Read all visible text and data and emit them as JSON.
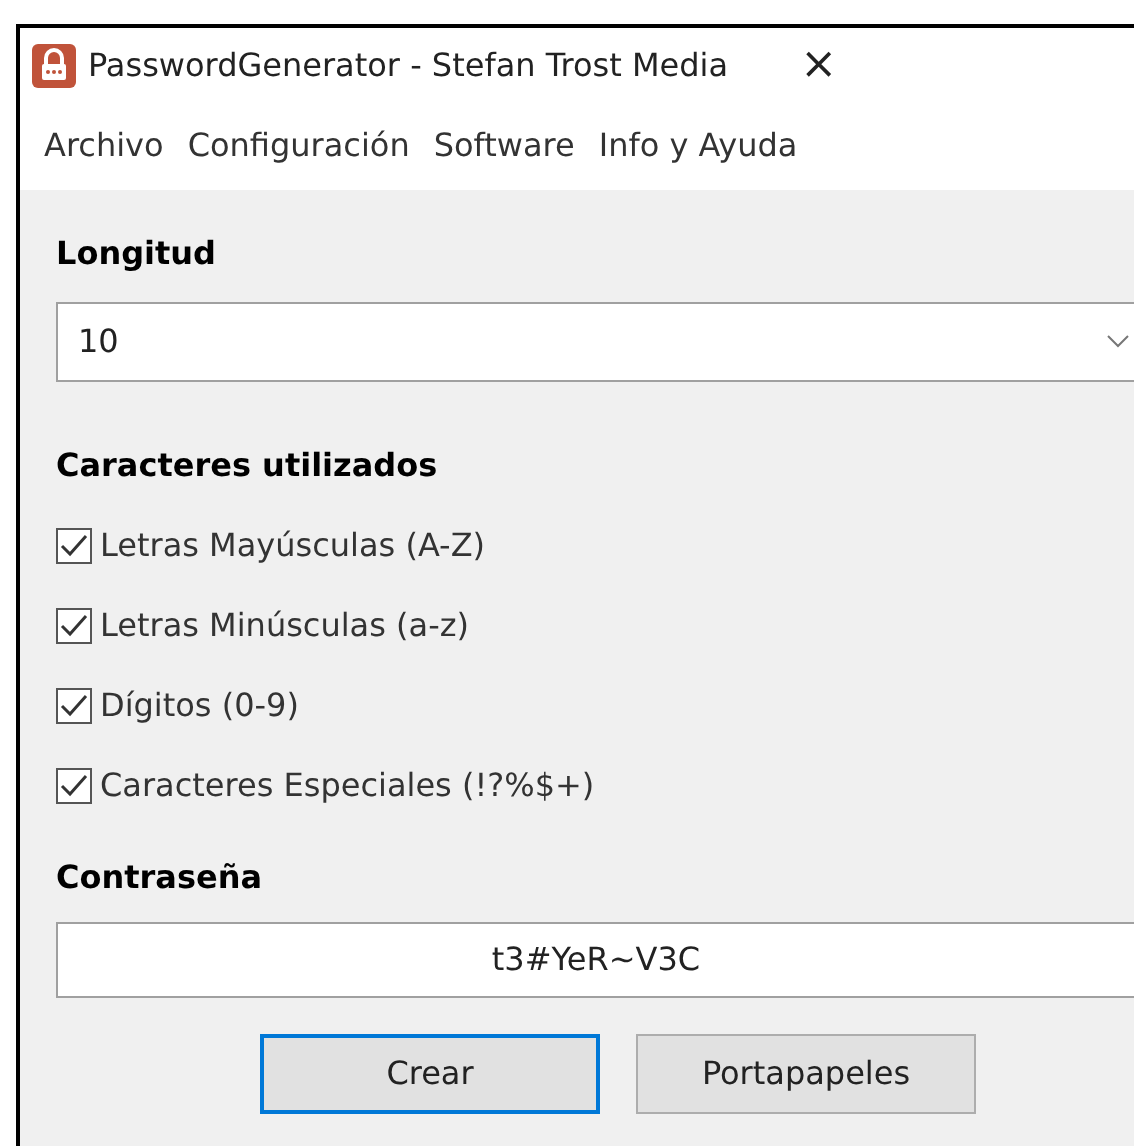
{
  "window": {
    "title": "PasswordGenerator - Stefan Trost Media",
    "close": "×"
  },
  "menu": [
    "Archivo",
    "Configuración",
    "Software",
    "Info y Ayuda"
  ],
  "length": {
    "label": "Longitud",
    "value": "10"
  },
  "characters": {
    "label": "Caracteres utilizados",
    "options": [
      {
        "label": "Letras Mayúsculas (A-Z)",
        "checked": true
      },
      {
        "label": "Letras Minúsculas (a-z)",
        "checked": true
      },
      {
        "label": "Dígitos (0-9)",
        "checked": true
      },
      {
        "label": "Caracteres Especiales (!?%$+)",
        "checked": true
      }
    ]
  },
  "password": {
    "label": "Contraseña",
    "value": "t3#YeR~V3C"
  },
  "buttons": [
    {
      "label": "Crear",
      "focused": true
    },
    {
      "label": "Portapapeles",
      "focused": false
    }
  ]
}
